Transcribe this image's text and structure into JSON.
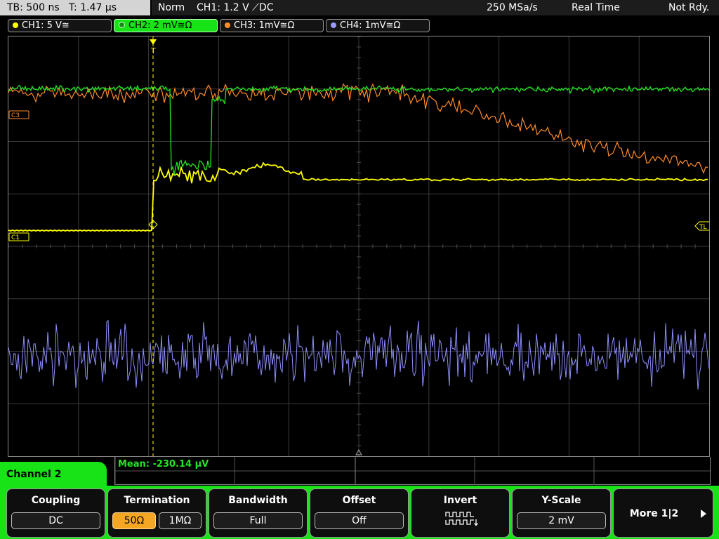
{
  "top_bar": {
    "timebase": "TB: 500 ns",
    "trigger_time": "T: 1.47 µs",
    "mode": "Norm",
    "trigger": "CH1: 1.2 V ⟋DC",
    "sample_rate": "250 MSa/s",
    "acquisition": "Real Time",
    "status": "Not Rdy."
  },
  "channel_tabs": [
    {
      "label": "CH1: 5 V≅",
      "color": "#ffff00",
      "active": false
    },
    {
      "label": "CH2: 2 mV≅Ω",
      "color": "#22e622",
      "active": true
    },
    {
      "label": "CH3: 1mV≅Ω",
      "color": "#ff8c2a",
      "active": false
    },
    {
      "label": "CH4: 1mV≅Ω",
      "color": "#9a9aff",
      "active": false
    }
  ],
  "markers": {
    "ch1": "C1",
    "ch3": "C3",
    "trigger_level": "TL",
    "trigger_pos": "T"
  },
  "colors": {
    "ch1": "#ffff00",
    "ch2": "#22e622",
    "ch3": "#ff8c2a",
    "ch4": "#8f8fff",
    "grid": "#3a3a3a",
    "accent": "#17e317",
    "selected": "#f5a623"
  },
  "measurement": {
    "mean": "Mean: -230.14 µV"
  },
  "menu": {
    "channel": "Channel 2",
    "coupling": {
      "title": "Coupling",
      "value": "DC"
    },
    "termination": {
      "title": "Termination",
      "opt1": "50Ω",
      "opt2": "1MΩ"
    },
    "bandwidth": {
      "title": "Bandwidth",
      "value": "Full"
    },
    "offset": {
      "title": "Offset",
      "value": "Off"
    },
    "invert": {
      "title": "Invert"
    },
    "yscale": {
      "title": "Y-Scale",
      "value": "2 mV"
    },
    "more": {
      "label": "More 1|2"
    }
  }
}
